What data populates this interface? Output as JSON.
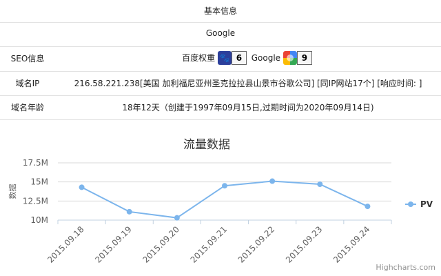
{
  "info": {
    "header": "基本信息",
    "title": "Google",
    "seo_label": "SEO信息",
    "baidu_label": "百度权重",
    "baidu_value": "6",
    "google_label": "Google",
    "google_value": "9",
    "domain_ip_label": "域名IP",
    "domain_ip_value": "216.58.221.238[美国 加利福尼亚州圣克拉拉县山景市谷歌公司]  [同IP网站17个]  [响应时间: ]",
    "domain_age_label": "域名年龄",
    "domain_age_value": "18年12天（创建于1997年09月15日,过期时间为2020年09月14日)"
  },
  "chart_data": {
    "type": "line",
    "title": "流量数据",
    "ylabel": "数据",
    "xlabel": "",
    "categories": [
      "2015.09.18",
      "2015.09.19",
      "2015.09.20",
      "2015.09.21",
      "2015.09.22",
      "2015.09.23",
      "2015.09.24"
    ],
    "series": [
      {
        "name": "PV",
        "values": [
          14.3,
          11.1,
          10.3,
          14.5,
          15.1,
          14.7,
          11.8
        ],
        "color": "#7cb5ec"
      }
    ],
    "ylim": [
      10,
      17.5
    ],
    "yticks": [
      "10M",
      "12.5M",
      "15M",
      "17.5M"
    ],
    "ytick_values": [
      10,
      12.5,
      15,
      17.5
    ],
    "grid": true,
    "legend": "right",
    "credit": "Highcharts.com"
  }
}
